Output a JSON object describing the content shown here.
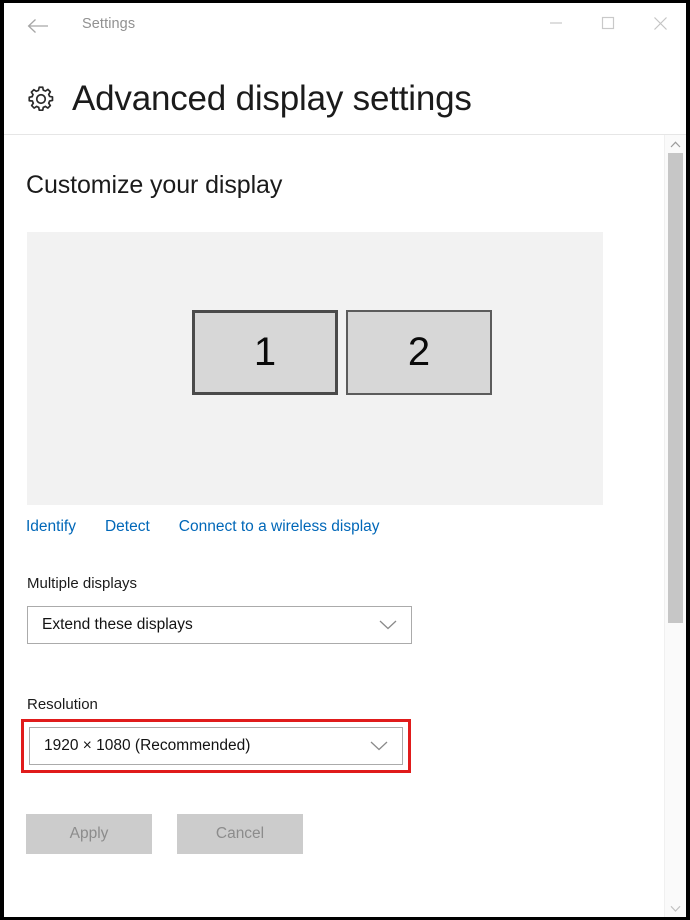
{
  "window": {
    "titlebar_title": "Settings",
    "back_label": "Back",
    "minimize_label": "Minimize",
    "maximize_label": "Maximize",
    "close_label": "Close"
  },
  "header": {
    "icon": "gear-icon",
    "title": "Advanced display settings"
  },
  "main": {
    "section_heading": "Customize your display",
    "display_preview": {
      "monitors": [
        {
          "label": "1",
          "selected": true
        },
        {
          "label": "2",
          "selected": false
        }
      ]
    },
    "links": [
      {
        "label": "Identify"
      },
      {
        "label": "Detect"
      },
      {
        "label": "Connect to a wireless display"
      }
    ],
    "fields": [
      {
        "label": "Multiple displays",
        "value": "Extend these displays",
        "chevron": "chevron-down-icon",
        "highlighted": false
      },
      {
        "label": "Resolution",
        "value": "1920 × 1080 (Recommended)",
        "chevron": "chevron-down-icon",
        "highlighted": true
      }
    ],
    "buttons": [
      {
        "label": "Apply",
        "disabled": true
      },
      {
        "label": "Cancel",
        "disabled": true
      }
    ]
  },
  "scrollbar": {
    "up_arrow": "chevron-up-icon",
    "down_arrow": "chevron-down-icon"
  },
  "colors": {
    "link": "#0067b8",
    "annotation": "#e01b1b",
    "preview_bg": "#f2f2f2",
    "monitor_fill": "#d7d7d7",
    "button_bg": "#cccccc"
  }
}
